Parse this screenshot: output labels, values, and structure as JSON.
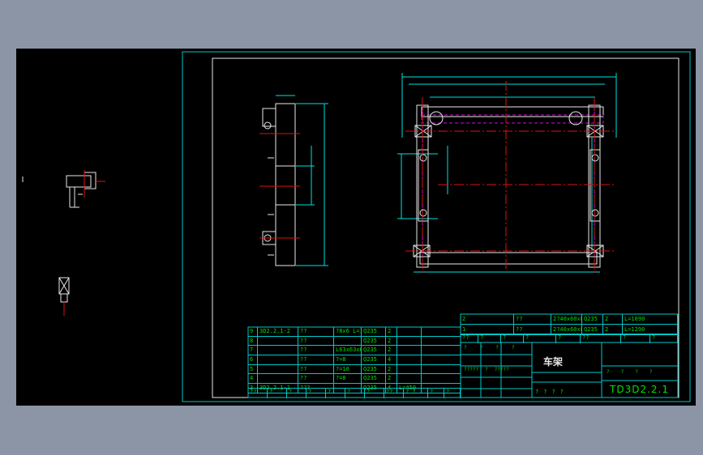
{
  "drawing": {
    "title_cn": "车架",
    "drawing_number": "TD3D2.2.1",
    "colors": {
      "frame": "#00c8c8",
      "part": "#e8e8e8",
      "dims": "#00e0e0",
      "table_text": "#00e000",
      "title_text": "#e8e8e8",
      "centerline": "#e01010",
      "hidden": "#e000e0",
      "background": "#000000",
      "app_bg": "#8c95a6"
    }
  },
  "bom_upper": [
    {
      "c1": "2",
      "c2": "??",
      "c3": "2?40x60x8",
      "c4": "Q235",
      "c5": "2",
      "c6": "L=1090"
    },
    {
      "c1": "1",
      "c2": "??",
      "c3": "2?40x60x8",
      "c4": "Q235",
      "c5": "2",
      "c6": "L=1290"
    }
  ],
  "bom_upper_header": [
    "??",
    "?",
    "?",
    "?",
    "?",
    "??",
    "?",
    "?"
  ],
  "bom_lower": [
    {
      "c1": "9",
      "c2": "3D2.2.1-2",
      "c3": "??",
      "c4": "?8x6 L=15",
      "c5": "Q235",
      "c6": "2"
    },
    {
      "c1": "8",
      "c2": "",
      "c3": "??",
      "c4": "",
      "c5": "Q235",
      "c6": "2"
    },
    {
      "c1": "7",
      "c2": "",
      "c3": "??",
      "c4": "L63x63x6",
      "c5": "Q235",
      "c6": "2"
    },
    {
      "c1": "6",
      "c2": "",
      "c3": "??",
      "c4": "?=8",
      "c5": "Q235",
      "c6": "4"
    },
    {
      "c1": "5",
      "c2": "",
      "c3": "??",
      "c4": "?=10",
      "c5": "Q235",
      "c6": "2"
    },
    {
      "c1": "4",
      "c2": "",
      "c3": "??",
      "c4": "?=8",
      "c5": "Q235",
      "c6": "2"
    },
    {
      "c1": "3",
      "c2": "3D2.2.1-1",
      "c3": "???",
      "c4": "",
      "c5": "Q235",
      "c6": "4",
      "c7": "L=450"
    }
  ],
  "bom_lower_header": [
    "??",
    "?",
    "?",
    "?",
    "?",
    "?",
    "?",
    "??",
    "? ?",
    "?",
    "?"
  ],
  "title_block": {
    "row_a": [
      "?",
      "?",
      "?",
      "?"
    ],
    "row_b": [
      "?????",
      "?",
      "?????"
    ],
    "scale_cells": [
      "?",
      "?",
      "?",
      "?"
    ],
    "bottom_row": [
      "?",
      "?",
      "?",
      "?"
    ]
  }
}
